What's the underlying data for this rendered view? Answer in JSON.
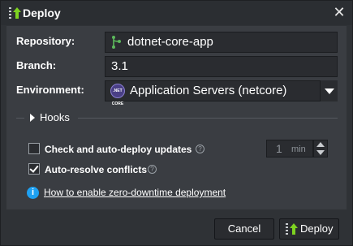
{
  "dialog": {
    "title": "Deploy",
    "close_symbol": "✕"
  },
  "form": {
    "repository_label": "Repository:",
    "repository_value": "dotnet-core-app",
    "repository_icon": "git-branch-icon",
    "branch_label": "Branch:",
    "branch_value": "3.1",
    "environment_label": "Environment:",
    "environment_value": "Application Servers (netcore)",
    "environment_icon": "netcore-icon",
    "environment_icon_text": ".NET CORE"
  },
  "hooks": {
    "label": "Hooks"
  },
  "options": {
    "auto_deploy_label": "Check and auto-deploy updates",
    "auto_deploy_checked": false,
    "auto_resolve_label": "Auto-resolve conflicts",
    "auto_resolve_checked": true,
    "help_symbol": "?",
    "interval_value": "1",
    "interval_unit": "min"
  },
  "info": {
    "symbol": "i",
    "link_text": "How to enable zero-downtime deployment"
  },
  "buttons": {
    "cancel_label": "Cancel",
    "deploy_label": "Deploy"
  },
  "colors": {
    "accent_green": "#7ed321",
    "info_blue": "#1ea1f2",
    "git_green": "#5cb85c"
  }
}
